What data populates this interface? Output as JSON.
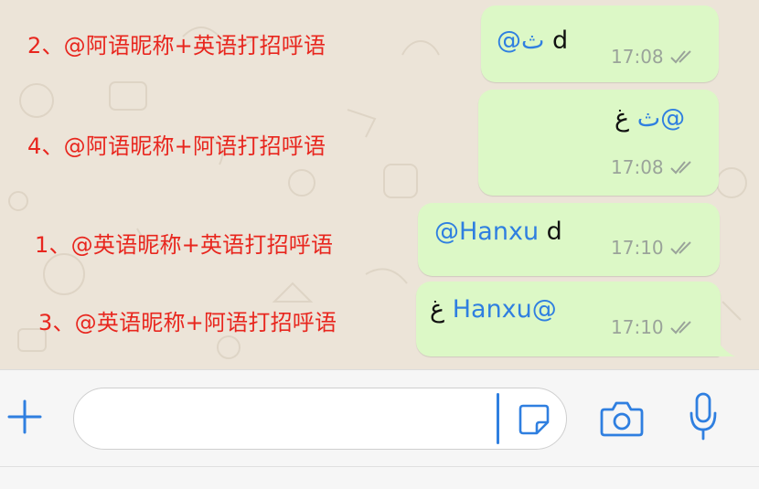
{
  "chat": {
    "messages": [
      {
        "annotation": "2、@阿语昵称+英语打招呼语",
        "mention": "@ث",
        "text": " d",
        "time": "17:08"
      },
      {
        "annotation": "4、@阿语昵称+阿语打招呼语",
        "mention": "@ث",
        "text": "غ",
        "time": "17:08"
      },
      {
        "annotation": "1、@英语昵称+英语打招呼语",
        "mention": "@Hanxu",
        "text": " d",
        "time": "17:10"
      },
      {
        "annotation": "3、@英语昵称+阿语打招呼语",
        "mention": "Hanxu@",
        "text": "غ",
        "time": "17:10"
      }
    ]
  },
  "composer": {
    "input_value": "",
    "icons": [
      "plus-icon",
      "sticker-icon",
      "camera-icon",
      "microphone-icon"
    ]
  },
  "colors": {
    "bubble": "#dcf8c6",
    "mention": "#2f7fe0",
    "annotation": "#e8261e",
    "wallpaper": "#ece4d8"
  }
}
